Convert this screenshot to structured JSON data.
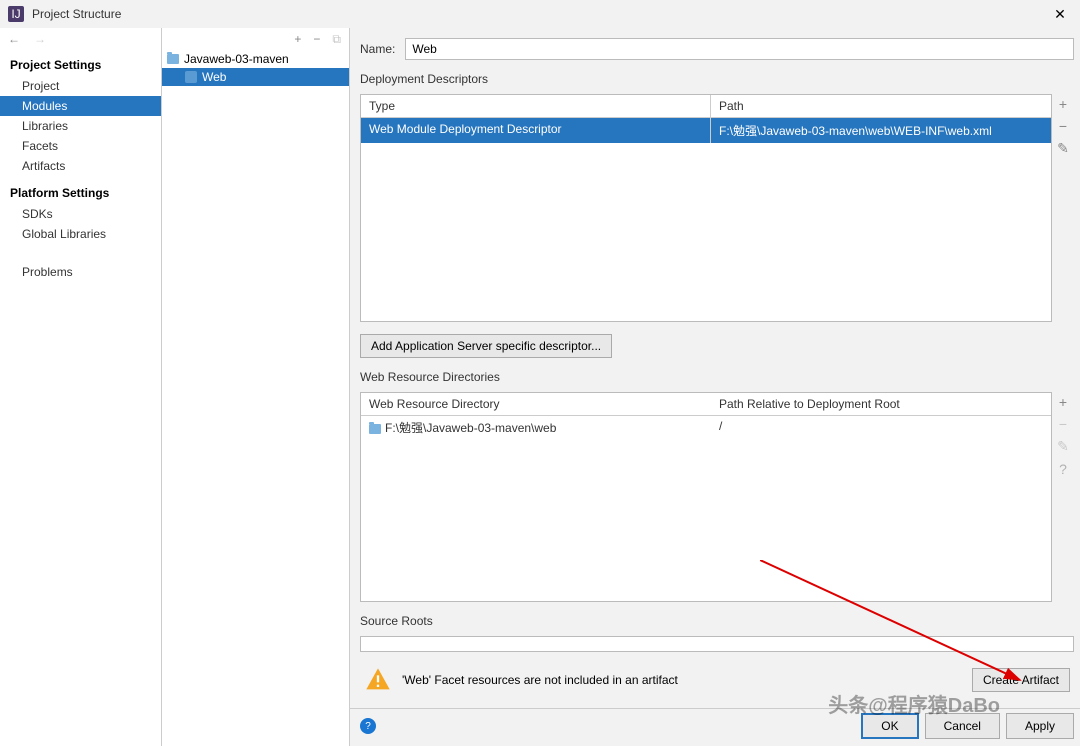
{
  "window": {
    "title": "Project Structure"
  },
  "sidebar": {
    "sections": [
      {
        "header": "Project Settings",
        "items": [
          "Project",
          "Modules",
          "Libraries",
          "Facets",
          "Artifacts"
        ],
        "selected": 1
      },
      {
        "header": "Platform Settings",
        "items": [
          "SDKs",
          "Global Libraries"
        ]
      },
      {
        "header": "",
        "items": [
          "Problems"
        ]
      }
    ]
  },
  "tree": {
    "root": {
      "label": "Javaweb-03-maven"
    },
    "child": {
      "label": "Web"
    }
  },
  "form": {
    "name_label": "Name:",
    "name_value": "Web"
  },
  "deployment": {
    "group_label": "Deployment Descriptors",
    "col1": "Type",
    "col2": "Path",
    "row": {
      "type": "Web Module Deployment Descriptor",
      "path": "F:\\勉强\\Javaweb-03-maven\\web\\WEB-INF\\web.xml"
    },
    "add_button": "Add Application Server specific descriptor..."
  },
  "webres": {
    "group_label": "Web Resource Directories",
    "col1": "Web Resource Directory",
    "col2": "Path Relative to Deployment Root",
    "row": {
      "dir": "F:\\勉强\\Javaweb-03-maven\\web",
      "rel": "/"
    }
  },
  "source": {
    "group_label": "Source Roots"
  },
  "warning": {
    "text": "'Web' Facet resources are not included in an artifact",
    "button": "Create Artifact"
  },
  "footer": {
    "ok": "OK",
    "cancel": "Cancel",
    "apply": "Apply"
  },
  "watermark": "头条@程序猿DaBo"
}
